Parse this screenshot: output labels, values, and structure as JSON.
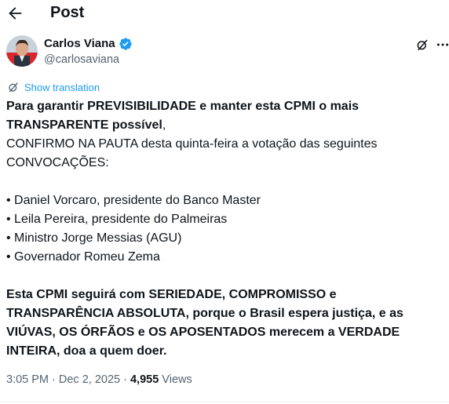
{
  "header": {
    "title": "Post",
    "back_icon": "arrow-left-icon"
  },
  "author": {
    "name": "Carlos Viana",
    "handle": "@carlosaviana",
    "verified_color": "#1d9bf0"
  },
  "translation": {
    "label": "Show translation"
  },
  "post": {
    "line1_bold": "Para garantir PREVISIBILIDADE e manter esta CPMI o mais",
    "line2_bold": "TRANSPARENTE possível",
    "line2_tail": ",",
    "line3": "CONFIRMO NA PAUTA desta quinta-feira a votação das seguintes",
    "line4": "CONVOCAÇÕES:",
    "bullets": [
      "• Daniel Vorcaro, presidente do Banco Master",
      "• Leila Pereira, presidente do Palmeiras",
      "• Ministro Jorge Messias (AGU)",
      "• Governador Romeu Zema"
    ],
    "closing": [
      "Esta CPMI seguirá com SERIEDADE, COMPROMISSO e",
      "TRANSPARÊNCIA ABSOLUTA, porque o Brasil espera justiça, e as",
      "VIÚVAS, OS ÓRFÃOS e OS APOSENTADOS merecem a VERDADE",
      "INTEIRA, doa a quem doer."
    ]
  },
  "meta": {
    "time": "3:05 PM",
    "separator": " · ",
    "date": "Dec 2, 2025",
    "separator2": " · ",
    "views_count": "4,955",
    "views_label": " Views"
  },
  "colors": {
    "accent": "#1d9bf0",
    "secondary_text": "#536471",
    "text": "#0f1419"
  }
}
